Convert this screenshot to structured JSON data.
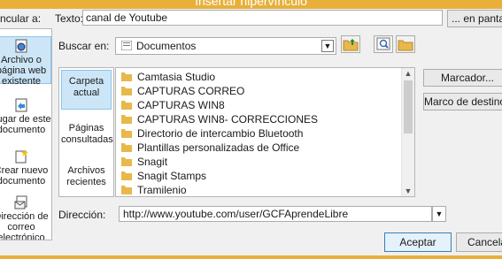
{
  "window": {
    "title": "Insertar hipervínculo"
  },
  "link_to": {
    "label": "ncular a:",
    "items": [
      {
        "label": "Archivo o página web existente",
        "icon": "globe-page-icon",
        "selected": true
      },
      {
        "label": "Lugar de este documento",
        "icon": "document-place-icon",
        "selected": false
      },
      {
        "label": "Crear nuevo documento",
        "icon": "new-document-icon",
        "selected": false
      },
      {
        "label": "Dirección de correo electrónico",
        "icon": "email-icon",
        "selected": false
      }
    ]
  },
  "text_to_display": {
    "label": "Texto:",
    "value": "canal de Youtube",
    "tip_button": "... en pantalla..."
  },
  "look_in": {
    "label": "Buscar en:",
    "value": "Documentos"
  },
  "scope": {
    "items": [
      {
        "label": "Carpeta actual",
        "selected": true
      },
      {
        "label": "Páginas consultadas",
        "selected": false
      },
      {
        "label": "Archivos recientes",
        "selected": false
      }
    ]
  },
  "files": [
    "Camtasia Studio",
    "CAPTURAS CORREO",
    "CAPTURAS WIN8",
    "CAPTURAS WIN8- CORRECCIONES",
    "Directorio de intercambio Bluetooth",
    "Plantillas personalizadas de Office",
    "Snagit",
    "Snagit Stamps",
    "Tramilenio"
  ],
  "side_buttons": {
    "bookmark": "Marcador...",
    "target_frame": "Marco de destino..."
  },
  "address": {
    "label": "Dirección:",
    "value": "http://www.youtube.com/user/GCFAprendeLibre"
  },
  "footer": {
    "ok": "Aceptar",
    "cancel": "Cancelar"
  },
  "colors": {
    "accent": "#e8b03a",
    "selection": "#cde6f7",
    "folder": "#e8b84a"
  }
}
